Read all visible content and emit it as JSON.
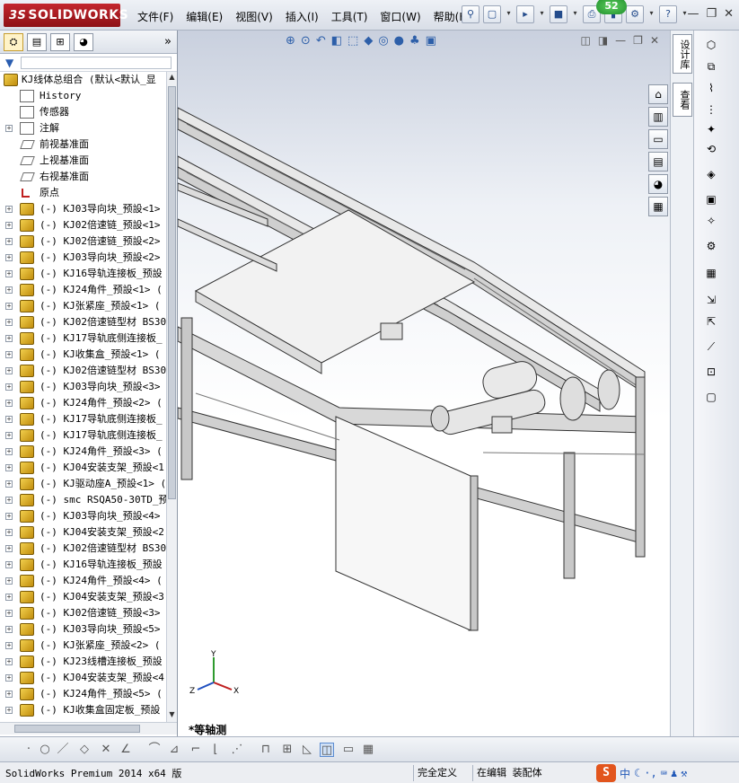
{
  "app": {
    "name": "SOLIDWORKS",
    "notification_count": "52"
  },
  "menu": [
    "文件(F)",
    "编辑(E)",
    "视图(V)",
    "插入(I)",
    "工具(T)",
    "窗口(W)",
    "帮助(H)"
  ],
  "panel_tabs": [
    "feature-manager",
    "property-manager",
    "configuration-manager",
    "display-manager"
  ],
  "tree": {
    "root": "KJ线体总组合  (默认<默认_显",
    "system_items": [
      {
        "icon": "history-icon",
        "label": "History"
      },
      {
        "icon": "sensor-icon",
        "label": "传感器"
      },
      {
        "icon": "annotation-icon",
        "label": "注解"
      },
      {
        "icon": "plane-icon",
        "label": "前视基准面"
      },
      {
        "icon": "plane-icon",
        "label": "上视基准面"
      },
      {
        "icon": "plane-icon",
        "label": "右视基准面"
      },
      {
        "icon": "origin-icon",
        "label": "原点"
      }
    ],
    "components": [
      "(-) KJ03导向块_预設<1>",
      "(-) KJ02倍速链_预設<1>",
      "(-) KJ02倍速链_预設<2>",
      "(-) KJ03导向块_预設<2>",
      "(-) KJ16导轨连接板_预設",
      "(-) KJ24角件_预設<1> (",
      "(-) KJ张紧座_预設<1> (",
      "(-) KJ02倍速链型材 BS30",
      "(-) KJ17导轨底侧连接板_",
      "(-) KJ收集盒_预設<1> (",
      "(-) KJ02倍速链型材 BS30",
      "(-) KJ03导向块_预設<3>",
      "(-) KJ24角件_预設<2> (",
      "(-) KJ17导轨底侧连接板_",
      "(-) KJ17导轨底侧连接板_",
      "(-) KJ24角件_预設<3> (",
      "(-) KJ04安装支架_预設<1",
      "(-) KJ驱动座A_预設<1> (",
      "(-) smc RSQA50-30TD_预韻",
      "(-) KJ03导向块_预設<4>",
      "(-) KJ04安装支架_预設<2",
      "(-) KJ02倍速链型材 BS30",
      "(-) KJ16导轨连接板_预設",
      "(-) KJ24角件_预設<4> (",
      "(-) KJ04安装支架_预設<3",
      "(-) KJ02倍速链_预設<3>",
      "(-) KJ03导向块_预設<5>",
      "(-) KJ张紧座_预設<2> (",
      "(-) KJ23线槽连接板_预設",
      "(-) KJ04安装支架_预設<4",
      "(-) KJ24角件_预設<5> (",
      "(-) KJ收集盒固定板_预設"
    ]
  },
  "viewport": {
    "view_name": "*等轴测",
    "triad": {
      "x": "X",
      "y": "Y",
      "z": "Z"
    }
  },
  "right_tabs": [
    "设计库",
    "查看"
  ],
  "status": {
    "product": "SolidWorks Premium 2014 x64 版",
    "definition": "完全定义",
    "mode": "在编辑 装配体"
  },
  "ime": {
    "lang": "中"
  },
  "colors": {
    "brand_red": "#b51d24",
    "accent_blue": "#2d5fa9",
    "part_yellow": "#e7b928"
  }
}
